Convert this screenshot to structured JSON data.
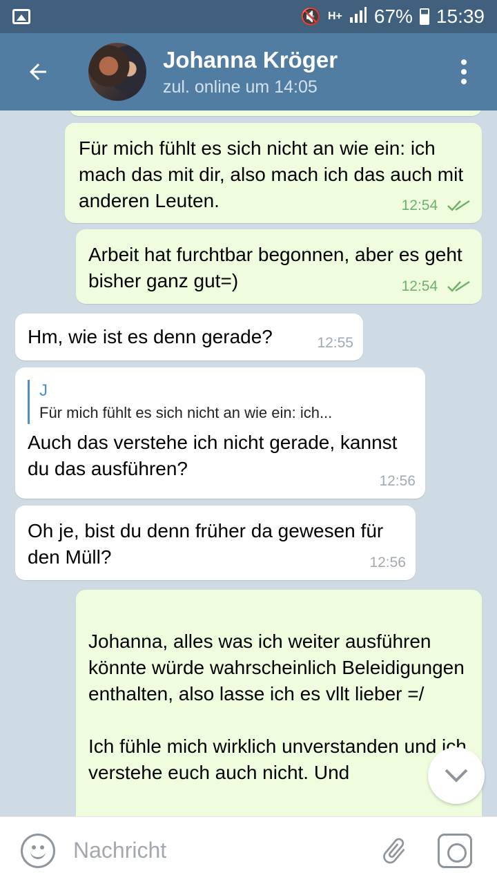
{
  "status_bar": {
    "battery": "67%",
    "time": "15:39",
    "network": "H+"
  },
  "header": {
    "contact_name": "Johanna Kröger",
    "last_seen": "zul. online um 14:05"
  },
  "messages": [
    {
      "direction": "out",
      "text": "Für mich fühlt es sich nicht an wie ein: ich mach das mit dir, also mach ich das auch mit anderen Leuten.",
      "time": "12:54",
      "read": true
    },
    {
      "direction": "out",
      "text": "Arbeit hat furchtbar begonnen, aber es geht bisher ganz gut=)",
      "time": "12:54",
      "read": true
    },
    {
      "direction": "in",
      "text": "Hm, wie ist es denn gerade?",
      "time": "12:55"
    },
    {
      "direction": "in",
      "reply_to": {
        "name": "J",
        "text": "Für mich fühlt es sich nicht an wie ein: ich..."
      },
      "text": "Auch das verstehe ich nicht gerade, kannst du das ausführen?",
      "time": "12:56"
    },
    {
      "direction": "in",
      "text": "Oh je, bist du denn früher da gewesen für den Müll?",
      "time": "12:56"
    },
    {
      "direction": "out",
      "text": "Johanna, alles was ich weiter ausführen könnte würde wahrscheinlich Beleidigungen enthalten, also lasse ich es vllt lieber =/\n\nIch fühle mich wirklich unverstanden und ich verstehe euch auch nicht. Und"
    }
  ],
  "composer": {
    "placeholder": "Nachricht"
  },
  "icons": {
    "back": "arrow-left-icon",
    "menu": "more-vertical-icon",
    "scroll_down": "chevron-down-icon",
    "emoji": "smiley-icon",
    "attach": "paperclip-icon",
    "camera": "camera-icon"
  },
  "colors": {
    "header": "#517da2",
    "status_bar": "#40607d",
    "outgoing_bubble": "#effdde",
    "incoming_bubble": "#ffffff",
    "read_check": "#6cb06a",
    "chat_background": "#cfdbe4"
  }
}
